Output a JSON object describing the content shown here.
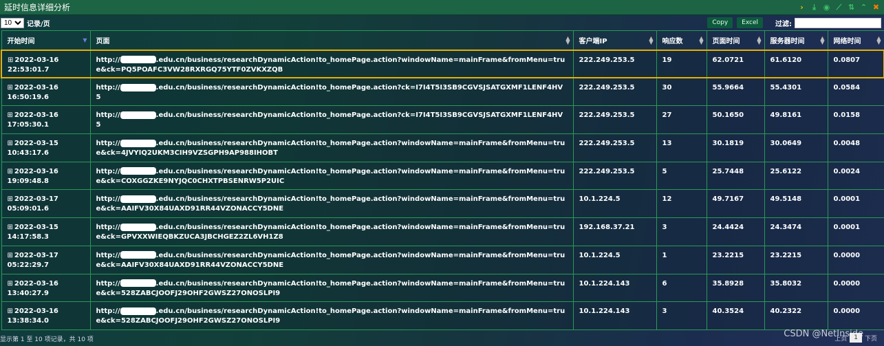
{
  "window": {
    "title": "延时信息详细分析",
    "icons": [
      "chevron-right-icon",
      "download-icon",
      "settings-circle-icon",
      "line-chart-icon",
      "sort-icon",
      "collapse-up-icon",
      "close-icon"
    ]
  },
  "toolbar": {
    "page_size": "10",
    "per_page_label": "记录/页",
    "copy_label": "Copy",
    "excel_label": "Excel",
    "filter_label": "过滤:",
    "filter_value": ""
  },
  "table": {
    "columns": [
      "开始时间",
      "页面",
      "客户端IP",
      "响应数",
      "页面时间",
      "服务器时间",
      "网络时间"
    ],
    "rows": [
      {
        "time": "2022-03-16 22:53:01.7",
        "url_prefix": "http://",
        "url": ".edu.cn/business/researchDynamicAction!to_homePage.action?windowName=mainFrame&fromMenu=true&ck=PQ5POAFC3VW28RXRGQ75YTF0ZVKXZQB",
        "ip": "222.249.253.5",
        "count": "19",
        "page": "62.0721",
        "server": "61.6120",
        "net": "0.0807"
      },
      {
        "time": "2022-03-16 16:50:19.6",
        "url_prefix": "http://",
        "url": ".edu.cn/business/researchDynamicAction!to_homePage.action?ck=I7I4T5I3SB9CGVSJSATGXMF1LENF4HV5",
        "ip": "222.249.253.5",
        "count": "30",
        "page": "55.9664",
        "server": "55.4301",
        "net": "0.0584"
      },
      {
        "time": "2022-03-16 17:05:30.1",
        "url_prefix": "http://",
        "url": ".edu.cn/business/researchDynamicAction!to_homePage.action?ck=I7I4T5I3SB9CGVSJSATGXMF1LENF4HV5",
        "ip": "222.249.253.5",
        "count": "27",
        "page": "50.1650",
        "server": "49.8161",
        "net": "0.0158"
      },
      {
        "time": "2022-03-15 10:43:17.6",
        "url_prefix": "http://",
        "url": ".edu.cn/business/researchDynamicAction!to_homePage.action?windowName=mainFrame&fromMenu=true&ck=4JVYIQ2UKM3CIH9VZSGPH9AP988IHOBT",
        "ip": "222.249.253.5",
        "count": "13",
        "page": "30.1819",
        "server": "30.0649",
        "net": "0.0048"
      },
      {
        "time": "2022-03-16 19:09:48.8",
        "url_prefix": "http://",
        "url": ".edu.cn/business/researchDynamicAction!to_homePage.action?windowName=mainFrame&fromMenu=true&ck=COXGGZKE9NYJQC0CHXTPBSENRW5P2UIC",
        "ip": "222.249.253.5",
        "count": "5",
        "page": "25.7448",
        "server": "25.6122",
        "net": "0.0024"
      },
      {
        "time": "2022-03-17 05:09:01.6",
        "url_prefix": "http://",
        "url": ".edu.cn/business/researchDynamicAction!to_homePage.action?windowName=mainFrame&fromMenu=true&ck=AAIFV30X84UAXD91RR44VZONACCY5DNE",
        "ip": "10.1.224.5",
        "count": "12",
        "page": "49.7167",
        "server": "49.5148",
        "net": "0.0001"
      },
      {
        "time": "2022-03-15 14:17:58.3",
        "url_prefix": "http://",
        "url": ".edu.cn/business/researchDynamicAction!to_homePage.action?windowName=mainFrame&fromMenu=true&ck=GPVXXWIEQBKZUCA3JBCHGEZ2ZL6VH1Z8",
        "ip": "192.168.37.21",
        "count": "3",
        "page": "24.4424",
        "server": "24.3474",
        "net": "0.0001"
      },
      {
        "time": "2022-03-17 05:22:29.7",
        "url_prefix": "http://",
        "url": ".edu.cn/business/researchDynamicAction!to_homePage.action?windowName=mainFrame&fromMenu=true&ck=AAIFV30X84UAXD91RR44VZONACCY5DNE",
        "ip": "10.1.224.5",
        "count": "1",
        "page": "23.2215",
        "server": "23.2215",
        "net": "0.0000"
      },
      {
        "time": "2022-03-16 13:40:27.9",
        "url_prefix": "http://",
        "url": ".edu.cn/business/researchDynamicAction!to_homePage.action?windowName=mainFrame&fromMenu=true&ck=528ZABCJOOFJ29OHF2GWSZ27ONOSLPI9",
        "ip": "10.1.224.143",
        "count": "6",
        "page": "35.8928",
        "server": "35.8032",
        "net": "0.0000"
      },
      {
        "time": "2022-03-16 13:38:34.0",
        "url_prefix": "http://",
        "url": ".edu.cn/business/researchDynamicAction!to_homePage.action?windowName=mainFrame&fromMenu=true&ck=528ZABCJOOFJ29OHF2GWSZ27ONOSLPI9",
        "ip": "10.1.224.143",
        "count": "3",
        "page": "40.3524",
        "server": "40.2322",
        "net": "0.0000"
      }
    ]
  },
  "footer": {
    "info": "显示第 1 至 10 项记录，共 10 项",
    "prev": "上页",
    "current": "1",
    "next": "下页"
  },
  "watermark": "CSDN @NetInside",
  "colors": {
    "titlebar": "#1c6444",
    "grid": "#2a9a55",
    "selected": "#e8b000",
    "icon": "#3fc06a",
    "close": "#ff7a00"
  }
}
